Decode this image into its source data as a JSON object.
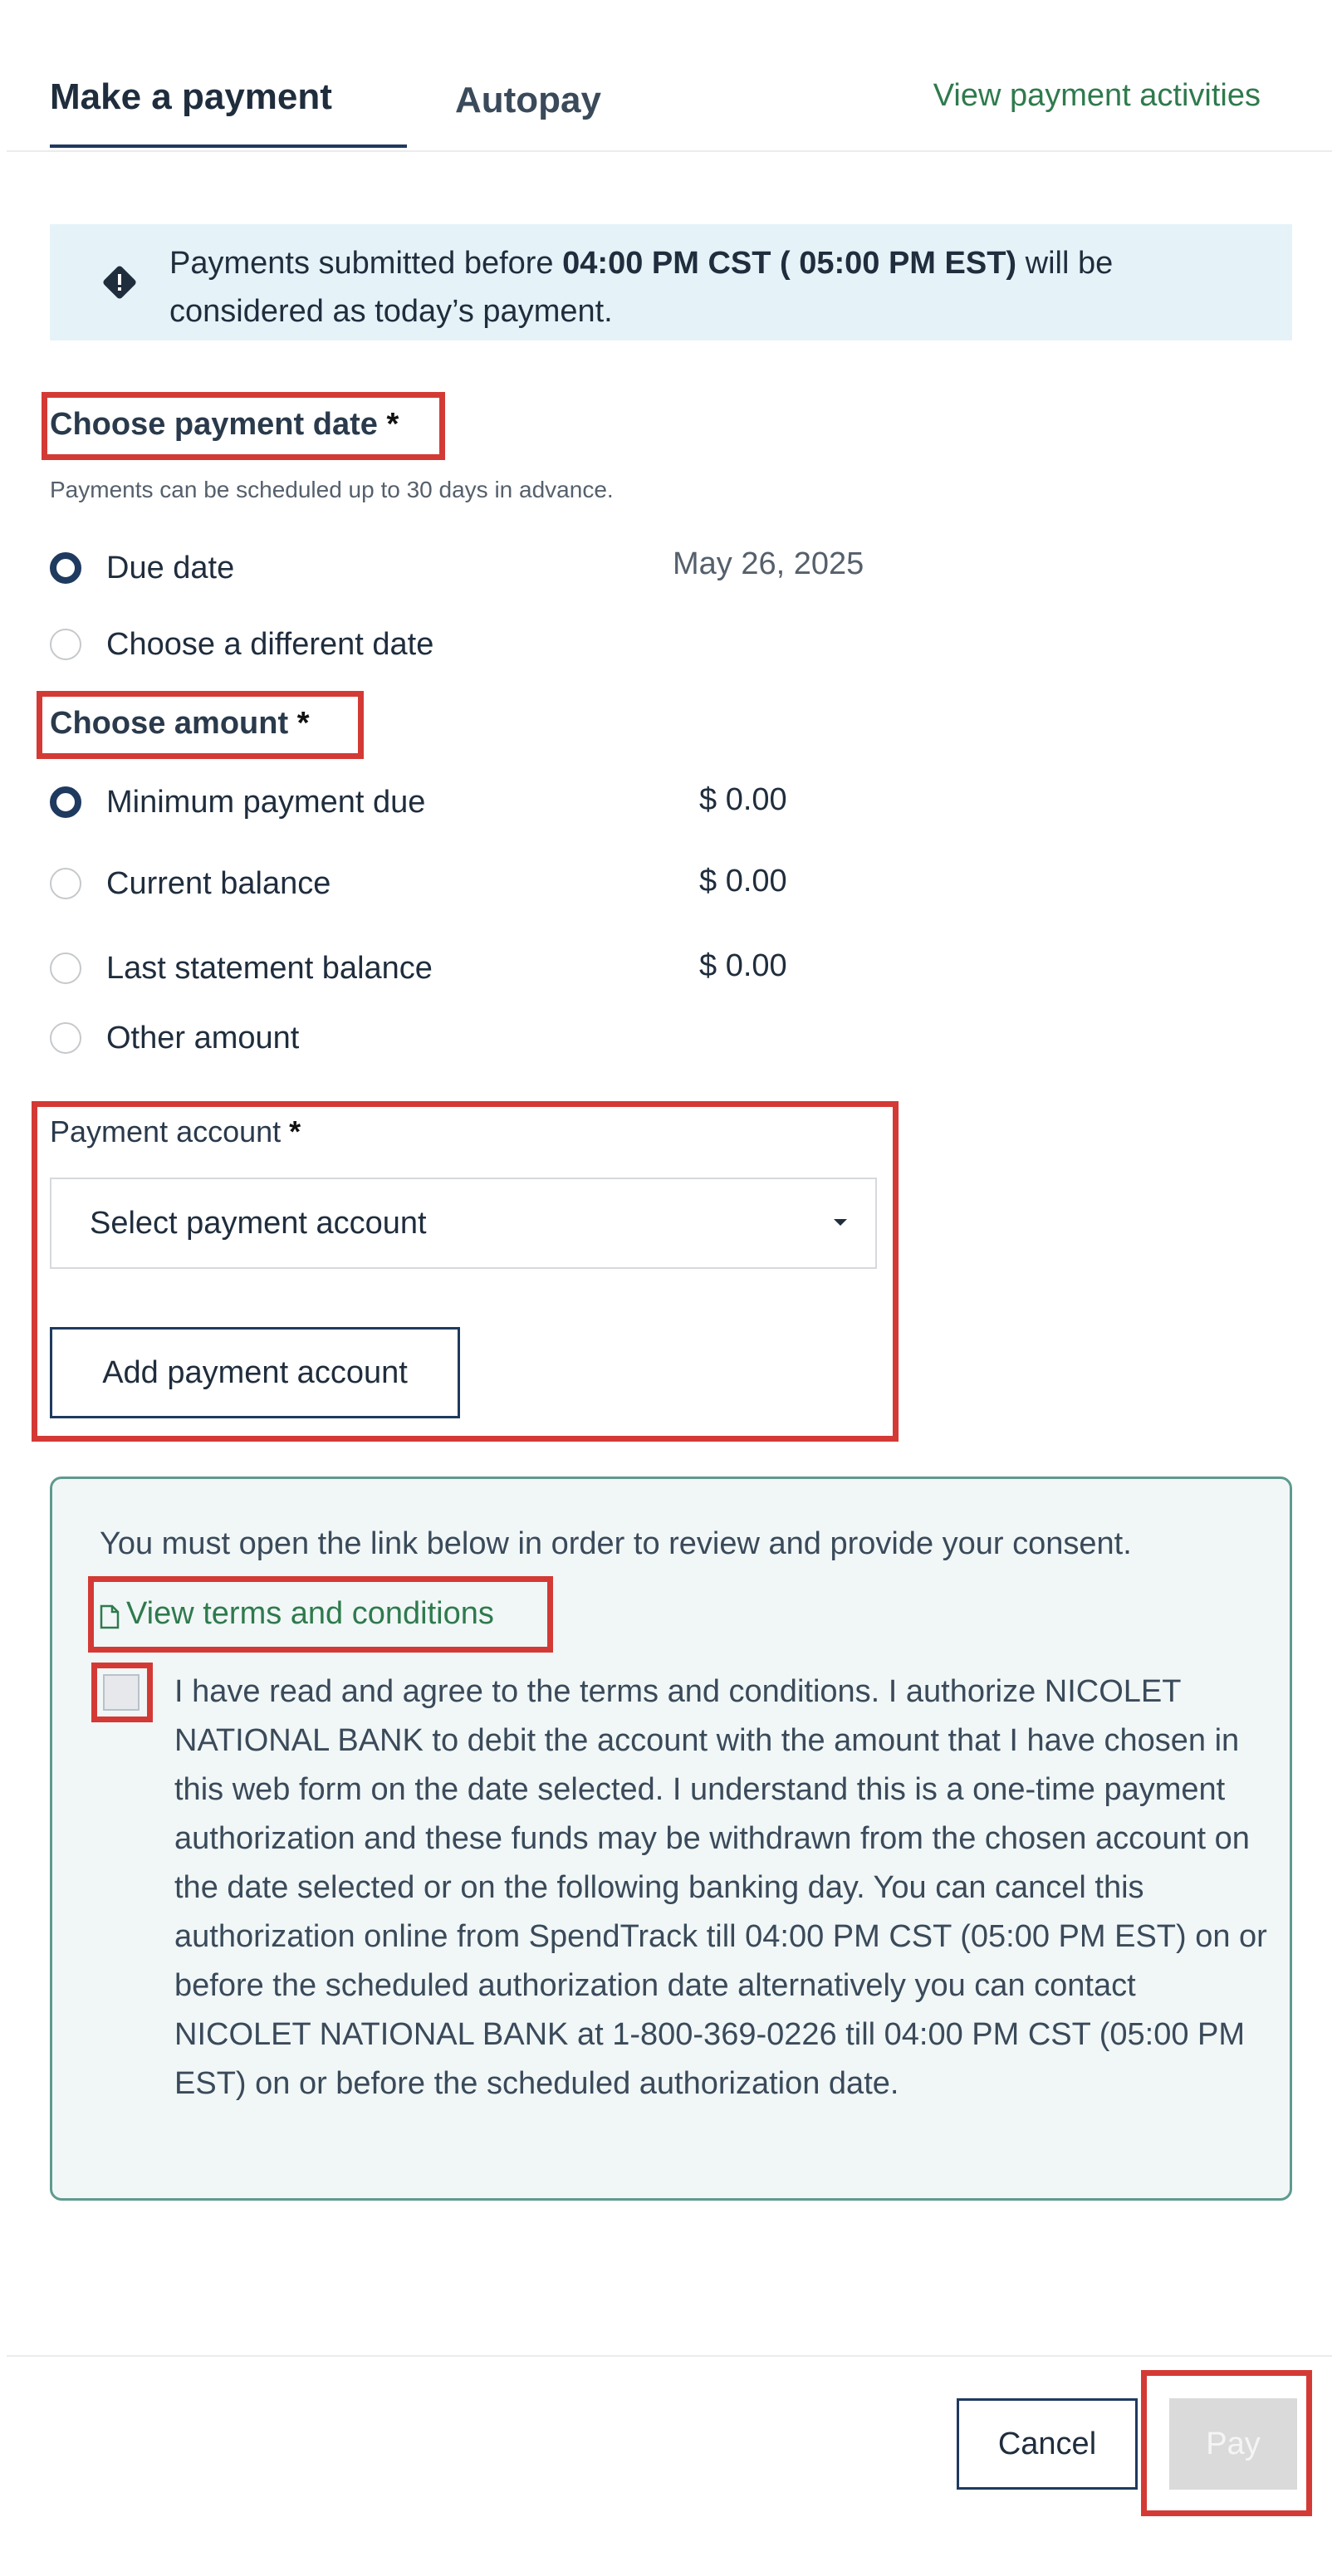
{
  "tabs": [
    {
      "label": "Make a payment",
      "active": true
    },
    {
      "label": "Autopay",
      "active": false
    }
  ],
  "header": {
    "view_activities": "View payment activities"
  },
  "info_banner": {
    "text_before": "Payments submitted before ",
    "time_bold": "04:00 PM CST ( 05:00 PM EST)",
    "text_after": " will be considered as today’s payment."
  },
  "payment_date": {
    "title": "Choose payment date",
    "required_mark": "*",
    "hint": "Payments can be scheduled up to 30 days in advance.",
    "options": [
      {
        "label": "Due date",
        "value": "May 26, 2025",
        "selected": true
      },
      {
        "label": "Choose a different date",
        "value": "",
        "selected": false
      }
    ]
  },
  "amount": {
    "title": "Choose amount",
    "required_mark": "*",
    "options": [
      {
        "label": "Minimum payment due",
        "value": "$ 0.00",
        "selected": true
      },
      {
        "label": "Current balance",
        "value": "$ 0.00",
        "selected": false
      },
      {
        "label": "Last statement balance",
        "value": "$ 0.00",
        "selected": false
      },
      {
        "label": "Other amount",
        "value": "",
        "selected": false
      }
    ]
  },
  "payment_account": {
    "label": "Payment account",
    "required_mark": "*",
    "select_value": "Select payment account",
    "add_button": "Add payment account"
  },
  "consent": {
    "intro": "You must open the link below in order to review and provide your consent.",
    "terms_link": "View terms and conditions",
    "checked": false,
    "text": "I have read and agree to the terms and conditions. I authorize NICOLET NATIONAL BANK to debit the account with the amount that I have chosen in this web form on the date selected. I understand this is a one-time payment authorization and these funds may be withdrawn from the chosen account on the date selected or on the following banking day. You can cancel this authorization online from SpendTrack till 04:00 PM CST (05:00 PM EST) on or before the scheduled authorization date alternatively you can contact NICOLET NATIONAL BANK at 1-800-369-0226 till 04:00 PM CST (05:00 PM EST) on or before the scheduled authorization date."
  },
  "footer": {
    "cancel": "Cancel",
    "pay": "Pay"
  },
  "colors": {
    "highlight_red": "#d43a35",
    "navy": "#1f3a5f",
    "link_green": "#2f7a4d",
    "info_bg": "#e5f3f8",
    "consent_border": "#5f9a8e",
    "pay_disabled_bg": "#dadada"
  }
}
